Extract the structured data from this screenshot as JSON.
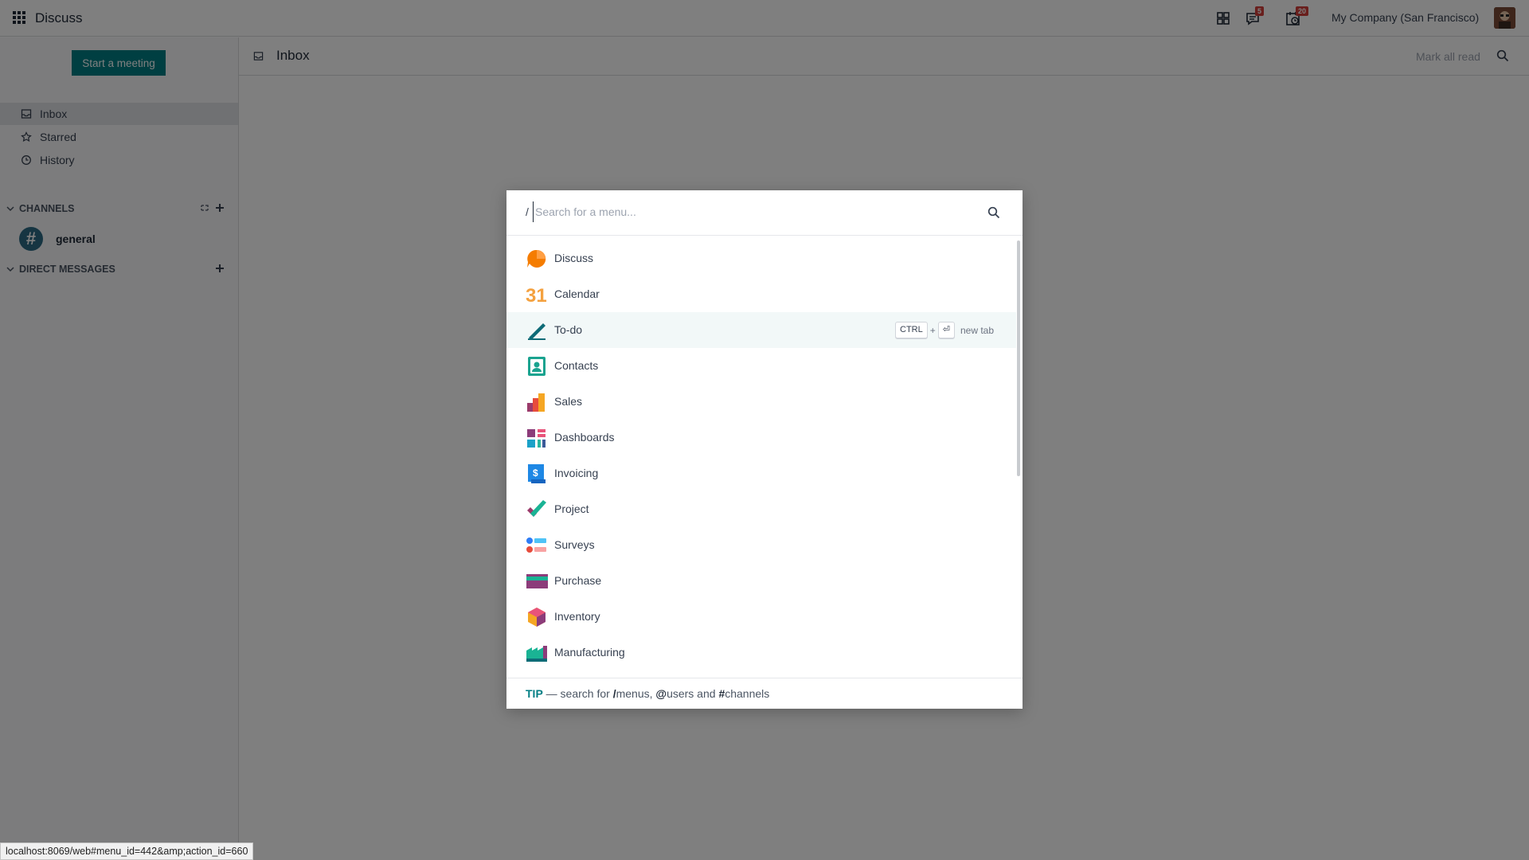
{
  "navbar": {
    "app_title": "Discuss",
    "messages_badge": "5",
    "activities_badge": "20",
    "company": "My Company (San Francisco)"
  },
  "sidebar": {
    "start_meeting": "Start a meeting",
    "items": [
      {
        "label": "Inbox",
        "icon": "inbox-icon"
      },
      {
        "label": "Starred",
        "icon": "star-icon"
      },
      {
        "label": "History",
        "icon": "history-icon"
      }
    ],
    "channels_label": "CHANNELS",
    "channel_general": "general",
    "direct_messages_label": "DIRECT MESSAGES"
  },
  "main": {
    "title": "Inbox",
    "mark_all_read": "Mark all read"
  },
  "command_palette": {
    "prefix": "/",
    "placeholder": "Search for a menu...",
    "items": [
      {
        "label": "Discuss"
      },
      {
        "label": "Calendar",
        "icon_text": "31"
      },
      {
        "label": "To-do"
      },
      {
        "label": "Contacts"
      },
      {
        "label": "Sales"
      },
      {
        "label": "Dashboards"
      },
      {
        "label": "Invoicing"
      },
      {
        "label": "Project"
      },
      {
        "label": "Surveys"
      },
      {
        "label": "Purchase"
      },
      {
        "label": "Inventory"
      },
      {
        "label": "Manufacturing"
      }
    ],
    "hint": {
      "key": "CTRL",
      "plus": "+",
      "enter": "⏎",
      "text": "new tab"
    },
    "tip": {
      "label": "TIP",
      "dash": " — search for ",
      "menus": "/",
      "menus_text": "menus, ",
      "users": "@",
      "users_text": "users and ",
      "channels": "#",
      "channels_text": "channels"
    }
  },
  "status_url": "localhost:8069/web#menu_id=442&amp;action_id=660",
  "colors": {
    "accent": "#017e84",
    "badge": "#d23f3a"
  }
}
